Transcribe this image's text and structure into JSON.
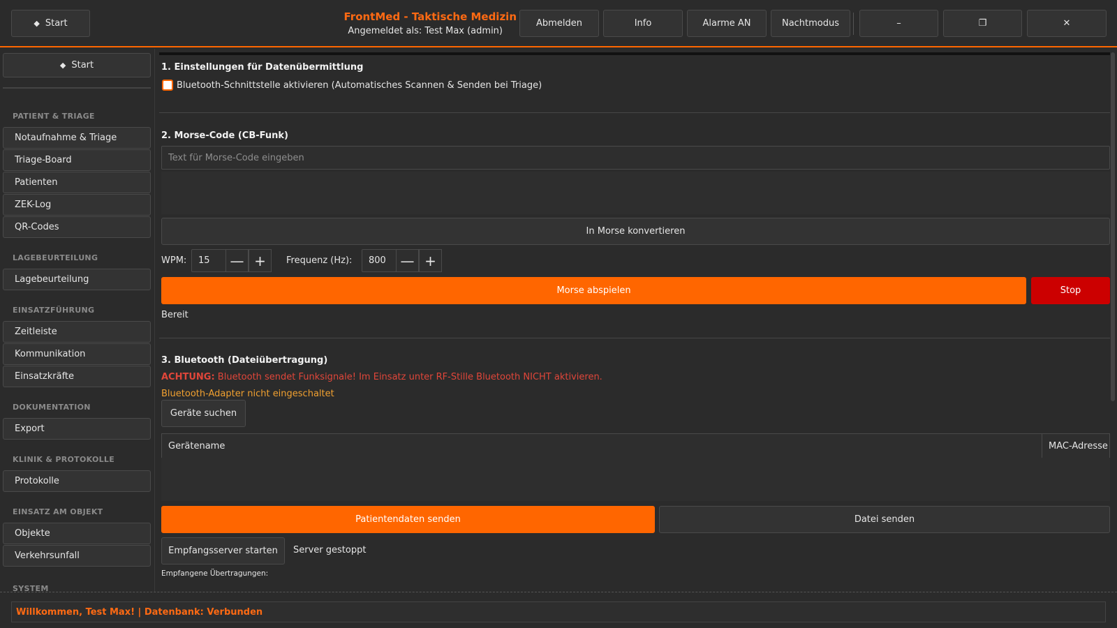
{
  "header": {
    "start_label": "Start",
    "app_title": "FrontMed - Taktische Medizin",
    "logged_in": "Angemeldet als: Test Max (admin)",
    "buttons": {
      "logout": "Abmelden",
      "info": "Info",
      "alarms": "Alarme AN",
      "night": "Nachtmodus",
      "minimize": "–",
      "maximize": "❐",
      "close": "✕"
    }
  },
  "sidebar": {
    "start_label": "Start",
    "sections": [
      {
        "title": "PATIENT & TRIAGE",
        "items": [
          "Notaufnahme & Triage",
          "Triage-Board",
          "Patienten",
          "ZEK-Log",
          "QR-Codes"
        ]
      },
      {
        "title": "LAGEBEURTEILUNG",
        "items": [
          "Lagebeurteilung"
        ]
      },
      {
        "title": "EINSATZFÜHRUNG",
        "items": [
          "Zeitleiste",
          "Kommunikation",
          "Einsatzkräfte"
        ]
      },
      {
        "title": "DOKUMENTATION",
        "items": [
          "Export"
        ]
      },
      {
        "title": "KLINIK & PROTOKOLLE",
        "items": [
          "Protokolle"
        ]
      },
      {
        "title": "EINSATZ AM OBJEKT",
        "items": [
          "Objekte",
          "Verkehrsunfall"
        ]
      },
      {
        "title": "SYSTEM",
        "items": []
      }
    ]
  },
  "settings": {
    "title": "1. Einstellungen für Datenübermittlung",
    "bt_checkbox_label": "Bluetooth-Schnittstelle aktivieren (Automatisches Scannen & Senden bei Triage)",
    "bt_checkbox_checked": false
  },
  "morse": {
    "title": "2. Morse-Code (CB-Funk)",
    "input_placeholder": "Text für Morse-Code eingeben",
    "input_value": "",
    "convert_button": "In Morse konvertieren",
    "wpm_label": "WPM:",
    "wpm_value": "15",
    "freq_label": "Frequenz (Hz):",
    "freq_value": "800",
    "minus_glyph": "—",
    "plus_glyph": "+",
    "play_button": "Morse abspielen",
    "stop_button": "Stop",
    "status": "Bereit"
  },
  "bluetooth": {
    "title": "3. Bluetooth (Dateiübertragung)",
    "warning_prefix": "ACHTUNG:",
    "warning_text": "Bluetooth sendet Funksignale! Im Einsatz unter RF-Stille Bluetooth NICHT aktivieren.",
    "adapter_status": "Bluetooth-Adapter nicht eingeschaltet",
    "search_button": "Geräte suchen",
    "table_headers": [
      "Gerätename",
      "MAC-Adresse"
    ],
    "table_rows": [],
    "send_patient_button": "Patientendaten senden",
    "send_file_button": "Datei senden",
    "server_button": "Empfangsserver starten",
    "server_status": "Server gestoppt",
    "received_label": "Empfangene Übertragungen:"
  },
  "statusbar": {
    "text": "Willkommen, Test Max! | Datenbank: Verbunden"
  },
  "colors": {
    "accent": "#ff6600",
    "stop": "#cc0000",
    "warning": "#e0463a",
    "adapter_status": "#f0a030"
  }
}
